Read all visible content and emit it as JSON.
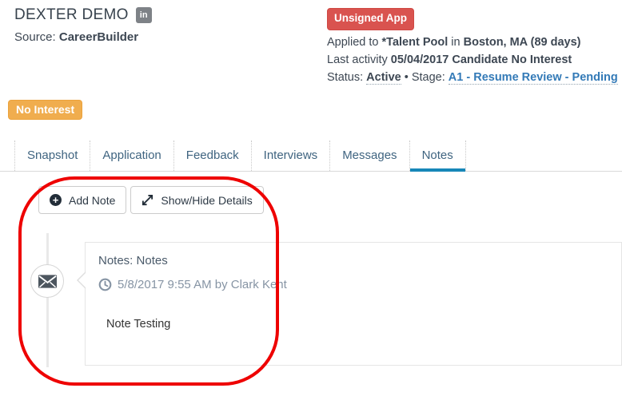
{
  "header": {
    "candidate_name": "DEXTER DEMO",
    "source_label": "Source:",
    "source_value": "CareerBuilder",
    "unsigned_badge": "Unsigned App",
    "applied_prefix": "Applied to",
    "applied_pool": "*Talent Pool",
    "applied_in": "in",
    "applied_location": "Boston, MA (89 days)",
    "last_activity_label": "Last activity",
    "last_activity_value": "05/04/2017 Candidate No Interest",
    "status_label": "Status:",
    "status_value": "Active",
    "separator": "•",
    "stage_label": "Stage:",
    "stage_value": "A1 - Resume Review - Pending",
    "interest_badge": "No Interest"
  },
  "tabs": [
    {
      "label": "Snapshot",
      "active": false
    },
    {
      "label": "Application",
      "active": false
    },
    {
      "label": "Feedback",
      "active": false
    },
    {
      "label": "Interviews",
      "active": false
    },
    {
      "label": "Messages",
      "active": false
    },
    {
      "label": "Notes",
      "active": true
    }
  ],
  "toolbar": {
    "add_note_label": "Add Note",
    "show_hide_label": "Show/Hide Details"
  },
  "note": {
    "title": "Notes: Notes",
    "timestamp": "5/8/2017 9:55 AM by Clark Kent",
    "body": "Note Testing"
  },
  "icons": {
    "linkedin": "linkedin-icon",
    "add": "plus-circle-icon",
    "expand": "expand-arrows-icon",
    "envelope": "envelope-icon",
    "clock": "clock-icon"
  },
  "colors": {
    "accent_blue": "#1787b8",
    "danger_red": "#d9534f",
    "warning_orange": "#f0ad4e",
    "link_blue": "#337ab7",
    "annotation_red": "#ee0000",
    "timeline_gray": "#e9e9e9"
  }
}
